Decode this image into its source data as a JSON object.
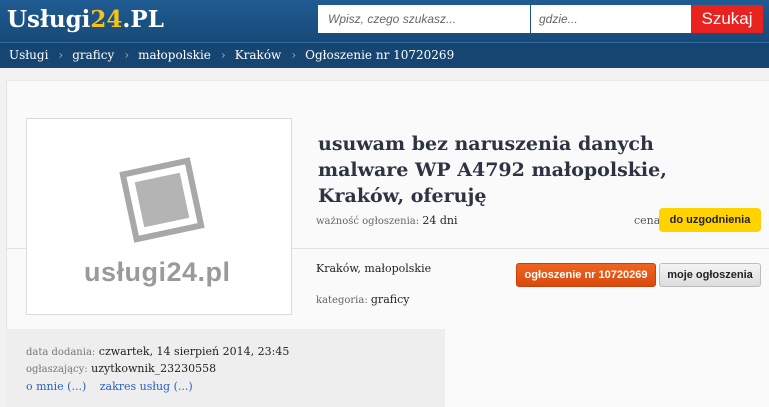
{
  "header": {
    "logo_part1": "Usługi",
    "logo_part2": "24",
    "logo_part3": ".PL",
    "search_what_placeholder": "Wpisz, czego szukasz...",
    "search_where_placeholder": "gdzie...",
    "search_button": "Szukaj"
  },
  "breadcrumb": {
    "items": [
      "Usługi",
      "graficy",
      "małopolskie",
      "Kraków",
      "Ogłoszenie nr 10720269"
    ],
    "separator": "›"
  },
  "listing": {
    "image_watermark": "usługi24.pl",
    "title": "usuwam bez naruszenia danych malware WP A4792 małopolskie, Kraków, oferuję",
    "validity_label": "ważność ogłoszenia:",
    "validity_value": "24 dni",
    "price_label": "cena",
    "price_value": "do uzgodnienia",
    "location": "Kraków, małopolskie",
    "category_label": "kategoria:",
    "category_value": "graficy",
    "ad_number_button": "ogłoszenie nr 10720269",
    "my_ads_button": "moje ogłoszenia"
  },
  "meta": {
    "date_label": "data dodania:",
    "date_value": "czwartek, 14 sierpień 2014, 23:45",
    "advertiser_label": "ogłaszający:",
    "advertiser_value": "uzytkownik_23230558",
    "about_link": "o mnie (...)",
    "services_link": "zakres usług (...)"
  },
  "colors": {
    "header_bg": "#1f5b92",
    "logo_accent": "#f6c21a",
    "search_button": "#e8231f",
    "price_badge": "#ffd200",
    "ad_number_button": "#e35518",
    "link": "#2b5fc0"
  }
}
